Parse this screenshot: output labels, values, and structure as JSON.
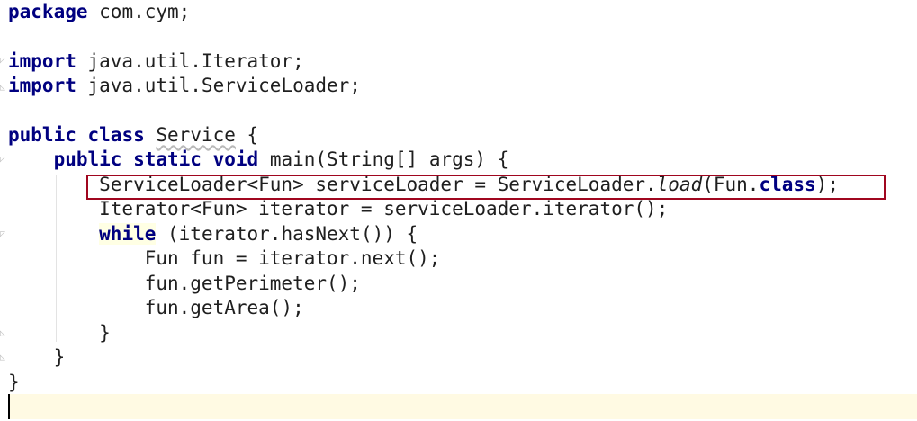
{
  "code_lines": [
    {
      "tokens": [
        {
          "text": "package",
          "kw": true
        },
        {
          "text": " com.cym;"
        }
      ]
    },
    {
      "tokens": []
    },
    {
      "tokens": [
        {
          "text": "import",
          "kw": true
        },
        {
          "text": " java.util.Iterator;"
        }
      ]
    },
    {
      "tokens": [
        {
          "text": "import",
          "kw": true
        },
        {
          "text": " java.util.ServiceLoader;"
        }
      ]
    },
    {
      "tokens": []
    },
    {
      "tokens": [
        {
          "text": "public",
          "kw": true
        },
        {
          "text": " "
        },
        {
          "text": "class",
          "kw": true
        },
        {
          "text": " "
        },
        {
          "text": "Service",
          "squiggle": true
        },
        {
          "text": " {"
        }
      ]
    },
    {
      "tokens": [
        {
          "text": "    "
        },
        {
          "text": "public",
          "kw": true
        },
        {
          "text": " "
        },
        {
          "text": "static",
          "kw": true
        },
        {
          "text": " "
        },
        {
          "text": "void",
          "kw": true
        },
        {
          "text": " main(String[] args) {"
        }
      ]
    },
    {
      "tokens": [
        {
          "text": "        ServiceLoader<Fun> serviceLoader = ServiceLoader."
        },
        {
          "text": "load",
          "italic": true
        },
        {
          "text": "(Fun."
        },
        {
          "text": "class",
          "kw": true
        },
        {
          "text": ");"
        }
      ]
    },
    {
      "tokens": [
        {
          "text": "        Iterator<Fun> iterator = serviceLoader.iterator();"
        }
      ]
    },
    {
      "tokens": [
        {
          "text": "        "
        },
        {
          "text": "while",
          "kw": true,
          "hl": true
        },
        {
          "text": " (iterator.hasNext()) {"
        }
      ]
    },
    {
      "tokens": [
        {
          "text": "            Fun fun = iterator.next();"
        }
      ]
    },
    {
      "tokens": [
        {
          "text": "            fun.getPerimeter();"
        }
      ]
    },
    {
      "tokens": [
        {
          "text": "            fun.getArea();"
        }
      ]
    },
    {
      "tokens": [
        {
          "text": "        }"
        }
      ]
    },
    {
      "tokens": [
        {
          "text": "    }"
        }
      ]
    },
    {
      "tokens": [
        {
          "text": "}"
        }
      ]
    }
  ],
  "colors": {
    "keyword": "#000080",
    "highlight_box": "#a0061f",
    "current_line": "#fffae3"
  }
}
